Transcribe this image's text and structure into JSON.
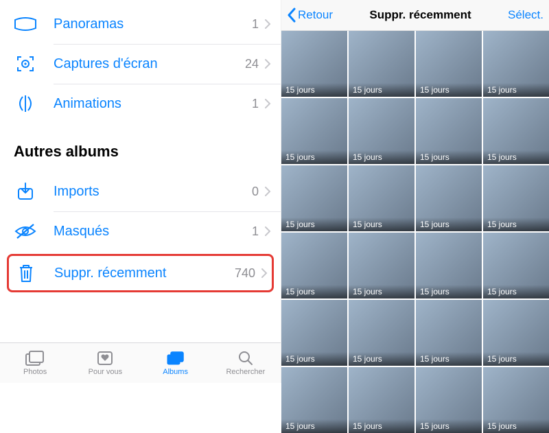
{
  "left": {
    "media_types": [
      {
        "icon": "panorama-icon",
        "label": "Panoramas",
        "count": "1"
      },
      {
        "icon": "screenshot-icon",
        "label": "Captures d'écran",
        "count": "24"
      },
      {
        "icon": "animations-icon",
        "label": "Animations",
        "count": "1"
      }
    ],
    "other_section_title": "Autres albums",
    "other_albums": [
      {
        "icon": "imports-icon",
        "label": "Imports",
        "count": "0"
      },
      {
        "icon": "hidden-icon",
        "label": "Masqués",
        "count": "1"
      },
      {
        "icon": "trash-icon",
        "label": "Suppr. récemment",
        "count": "740",
        "highlight": true
      }
    ],
    "tabs": [
      {
        "icon": "photos-tab-icon",
        "label": "Photos",
        "active": false
      },
      {
        "icon": "foryou-tab-icon",
        "label": "Pour vous",
        "active": false
      },
      {
        "icon": "albums-tab-icon",
        "label": "Albums",
        "active": true
      },
      {
        "icon": "search-tab-icon",
        "label": "Rechercher",
        "active": false
      }
    ]
  },
  "right": {
    "nav": {
      "back": "Retour",
      "title": "Suppr. récemment",
      "action": "Sélect."
    },
    "days_label": "15 jours",
    "thumbs": [
      "c-a",
      "c-a",
      "c-a",
      "c-a",
      "c-c",
      "c-c",
      "c-d",
      "c-d",
      "c-d",
      "c-d",
      "c-d",
      "c-d",
      "c-d",
      "c-d",
      "c-d",
      "c-d",
      "c-i",
      "c-g",
      "c-f",
      "c-h",
      "c-k",
      "c-c",
      "c-j",
      "c-c"
    ]
  }
}
